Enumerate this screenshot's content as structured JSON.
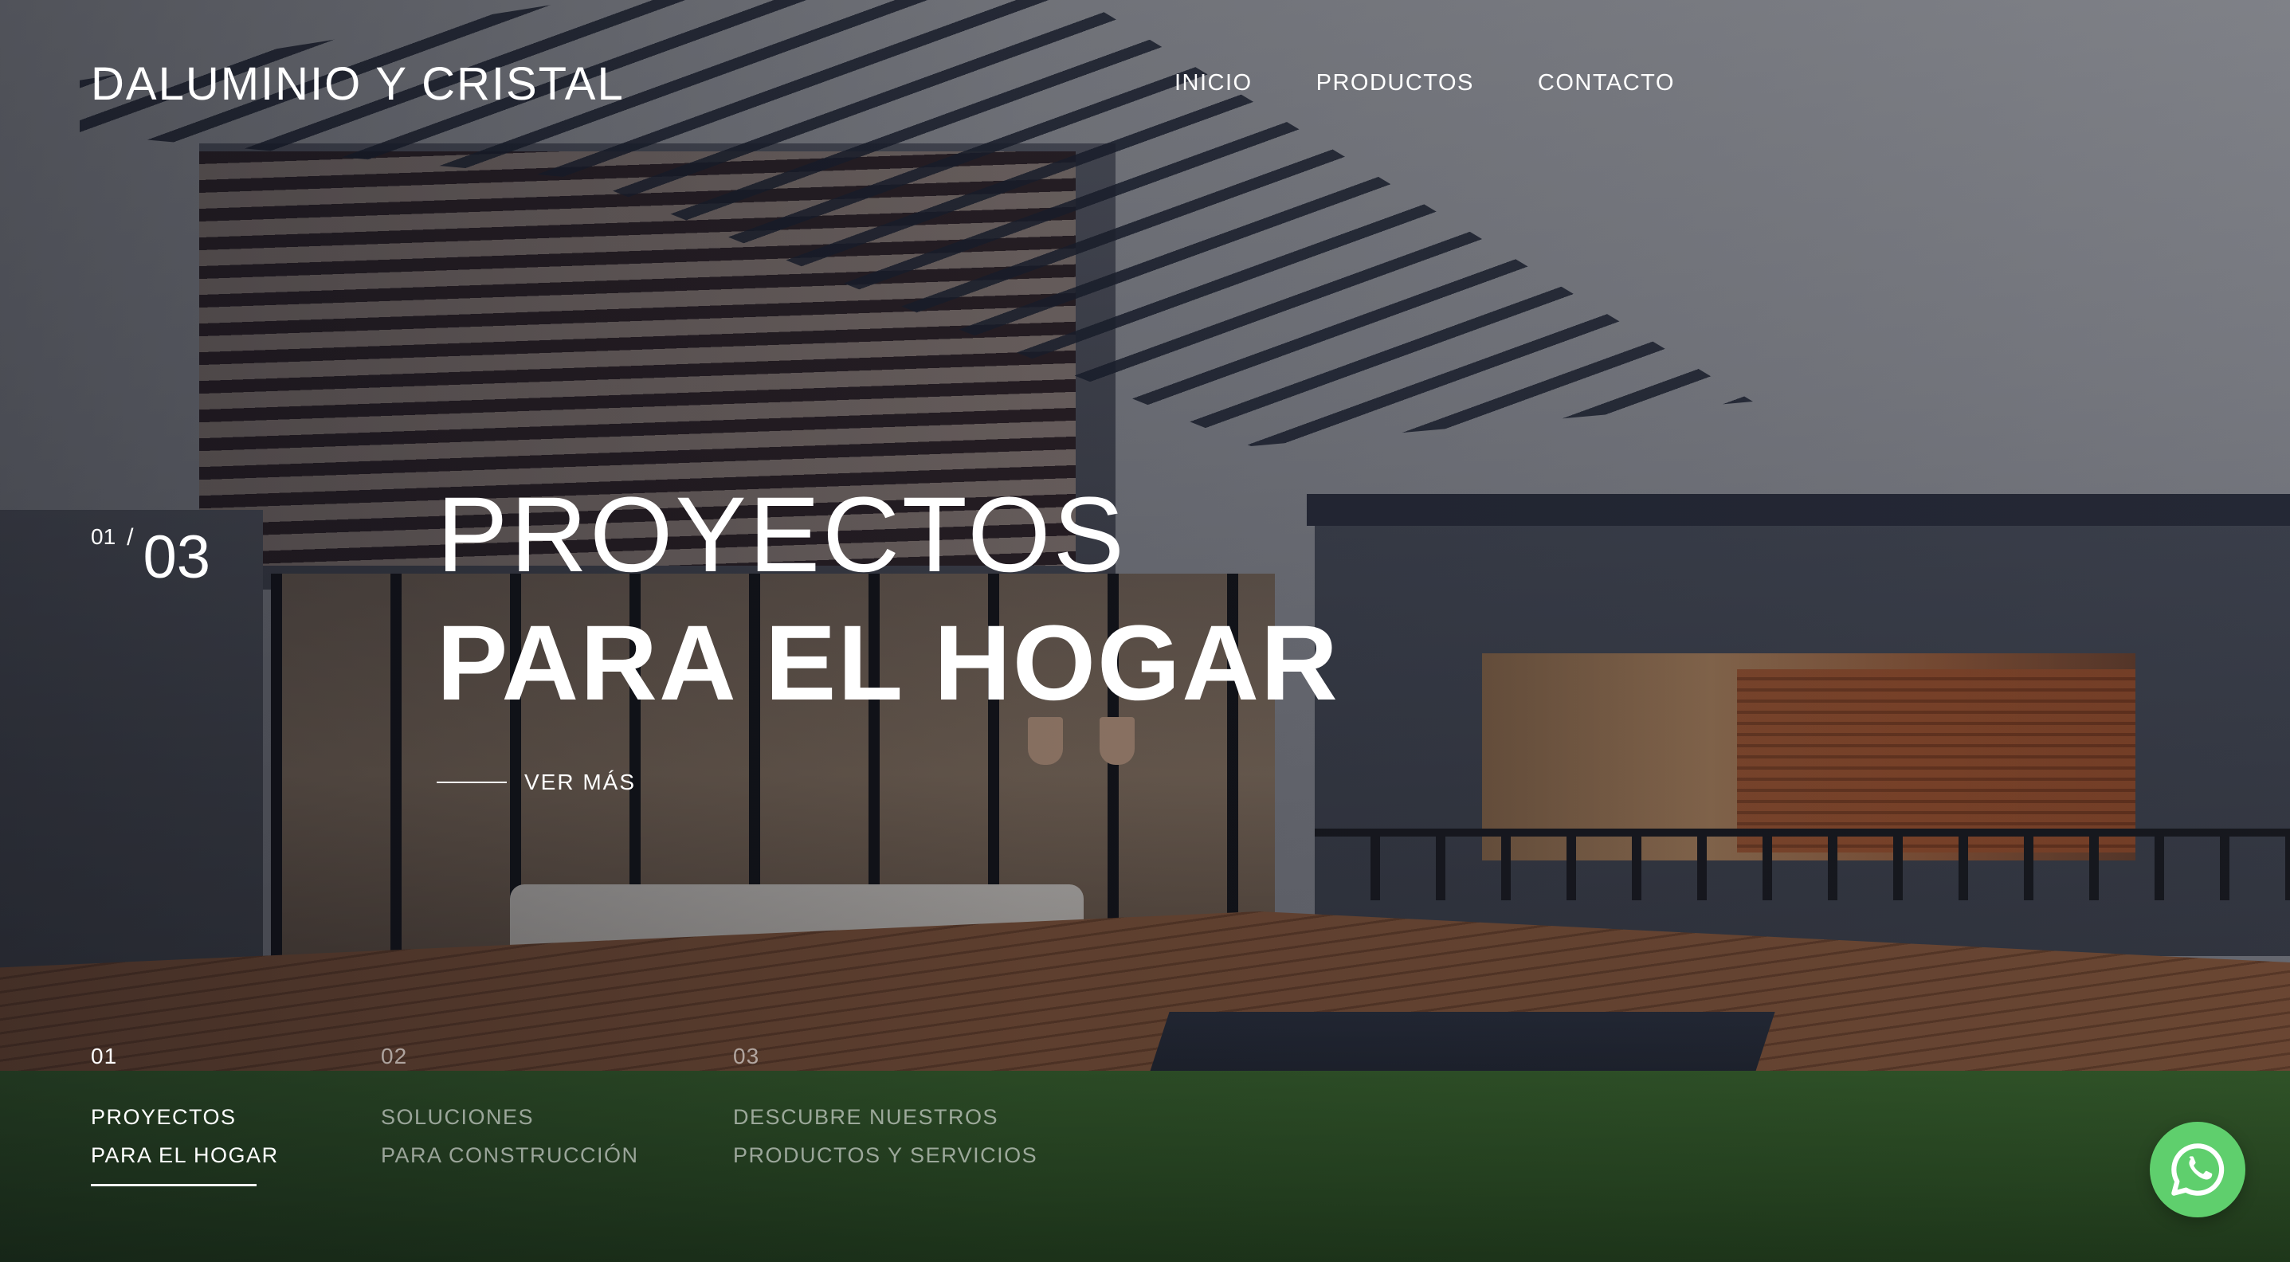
{
  "header": {
    "brand": "DALUMINIO Y CRISTAL",
    "nav": [
      "INICIO",
      "PRODUCTOS",
      "CONTACTO"
    ]
  },
  "slider": {
    "current": "01",
    "separator": "/",
    "total": "03"
  },
  "hero": {
    "title_line1": "PROYECTOS",
    "title_line2": "PARA EL HOGAR",
    "cta_label": "VER MÁS"
  },
  "tabs": [
    {
      "number": "01",
      "line1": "PROYECTOS",
      "line2": "PARA EL HOGAR",
      "active": true
    },
    {
      "number": "02",
      "line1": "SOLUCIONES",
      "line2": "PARA CONSTRUCCIÓN",
      "active": false
    },
    {
      "number": "03",
      "line1": "DESCUBRE NUESTROS",
      "line2": "PRODUCTOS Y SERVICIOS",
      "active": false
    }
  ],
  "floating": {
    "icon": "whatsapp-icon",
    "color": "#5fcf6d"
  }
}
